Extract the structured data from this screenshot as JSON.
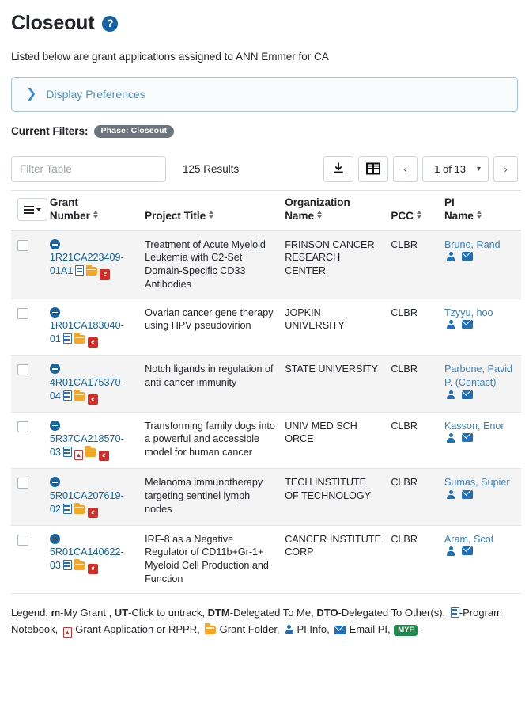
{
  "header": {
    "title": "Closeout",
    "help_icon": "question-mark-circle-icon",
    "subtitle_part1": "Listed below are grant applications",
    "subtitle_part2": "assigned to ANN Emmer for CA"
  },
  "display_preferences": {
    "label": "Display Preferences",
    "chevron": "chevron-right-icon",
    "expanded": false
  },
  "current_filters": {
    "label": "Current Filters:",
    "pills": [
      "Phase: Closeout"
    ]
  },
  "toolbar": {
    "filter_placeholder": "Filter Table",
    "filter_value": "",
    "results_text": "125 Results",
    "download_icon": "download-icon",
    "grid_icon": "grid-view-icon",
    "prev_label": "‹",
    "next_label": "›",
    "page_label": "1 of 13",
    "caret": "⌄"
  },
  "table": {
    "menu_button": "column-menu-button",
    "columns": [
      {
        "line1": "Grant",
        "line2": "Number",
        "sortable": true
      },
      {
        "line1": "",
        "line2": "Project Title",
        "sortable": true
      },
      {
        "line1": "Organization",
        "line2": "Name",
        "sortable": true
      },
      {
        "line1": "",
        "line2": "PCC",
        "sortable": true
      },
      {
        "line1": "PI",
        "line2": "Name",
        "sortable": true
      }
    ],
    "rows": [
      {
        "grant_number_line1": "1R21CA223409-",
        "grant_number_line2": "01A1",
        "icons": [
          "notebook",
          "folder",
          "era"
        ],
        "project_title": "Treatment of Acute Myeloid Leukemia with C2-Set Domain-Specific CD33 Antibodies",
        "organization": "FRINSON CANCER RESEARCH CENTER",
        "pcc": "CLBR",
        "pi_name": "Bruno, Rand"
      },
      {
        "grant_number_line1": "1R01CA183040-",
        "grant_number_line2": "01",
        "icons": [
          "notebook",
          "folder",
          "era"
        ],
        "project_title": "Ovarian cancer gene therapy using HPV pseudovirion",
        "organization": "JOPKIN UNIVERSITY",
        "pcc": "CLBR",
        "pi_name": "Tzyyu, hoo"
      },
      {
        "grant_number_line1": "4R01CA175370-",
        "grant_number_line2": "04",
        "icons": [
          "notebook",
          "folder",
          "era"
        ],
        "project_title": "Notch ligands in regulation of anti-cancer immunity",
        "organization": "STATE UNIVERSITY",
        "pcc": "CLBR",
        "pi_name": "Parbone, Pavid P. (Contact)"
      },
      {
        "grant_number_line1": "5R37CA218570-",
        "grant_number_line2": "03",
        "icons": [
          "notebook",
          "pdf",
          "folder",
          "era"
        ],
        "project_title": "Transforming family dogs into a powerful and accessible model for human cancer",
        "organization": "UNIV MED SCH ORCE",
        "pcc": "CLBR",
        "pi_name": "Kasson, Enor"
      },
      {
        "grant_number_line1": "5R01CA207619-",
        "grant_number_line2": "02",
        "icons": [
          "notebook",
          "folder",
          "era"
        ],
        "project_title": "Melanoma immunotherapy targeting sentinel lymph nodes",
        "organization": "TECH INSTITUTE OF TECHNOLOGY",
        "pcc": "CLBR",
        "pi_name": "Sumas, Supier"
      },
      {
        "grant_number_line1": "5R01CA140622-",
        "grant_number_line2": "03",
        "icons": [
          "notebook",
          "folder",
          "era"
        ],
        "project_title": "IRF-8 as a Negative Regulator of CD11b+Gr-1+ Myeloid Cell Production and Function",
        "organization": "CANCER INSTITUTE CORP",
        "pcc": "CLBR",
        "pi_name": "Aram, Scot"
      }
    ]
  },
  "legend": {
    "prefix": "Legend: ",
    "items": [
      {
        "key": "m",
        "bold": true,
        "text": "-My Grant , "
      },
      {
        "key": "UT",
        "bold": true,
        "text": "-Click to untrack, "
      },
      {
        "key": "DTM",
        "bold": true,
        "text": "-Delegated To Me, "
      },
      {
        "key": "DTO",
        "bold": true,
        "text": "-Delegated To Other(s), "
      }
    ],
    "icon_items": [
      {
        "icon": "notebook",
        "text": "-Program Notebook, "
      },
      {
        "icon": "pdf",
        "text": "-Grant Application or RPPR, "
      },
      {
        "icon": "folder",
        "text": "-Grant Folder, "
      },
      {
        "icon": "person",
        "text": "-PI Info, "
      },
      {
        "icon": "mail",
        "text": "-Email PI, "
      }
    ],
    "myf_badge": "MYF",
    "myf_suffix": "-"
  },
  "colors": {
    "link_blue": "#1464A5",
    "pi_link_blue": "#3c7fc0",
    "panel_border": "#9ec5e8",
    "pill_gray": "#6c757d",
    "myf_green": "#1d8a4e",
    "folder_orange": "#f5a623",
    "era_red": "#d42b26"
  }
}
